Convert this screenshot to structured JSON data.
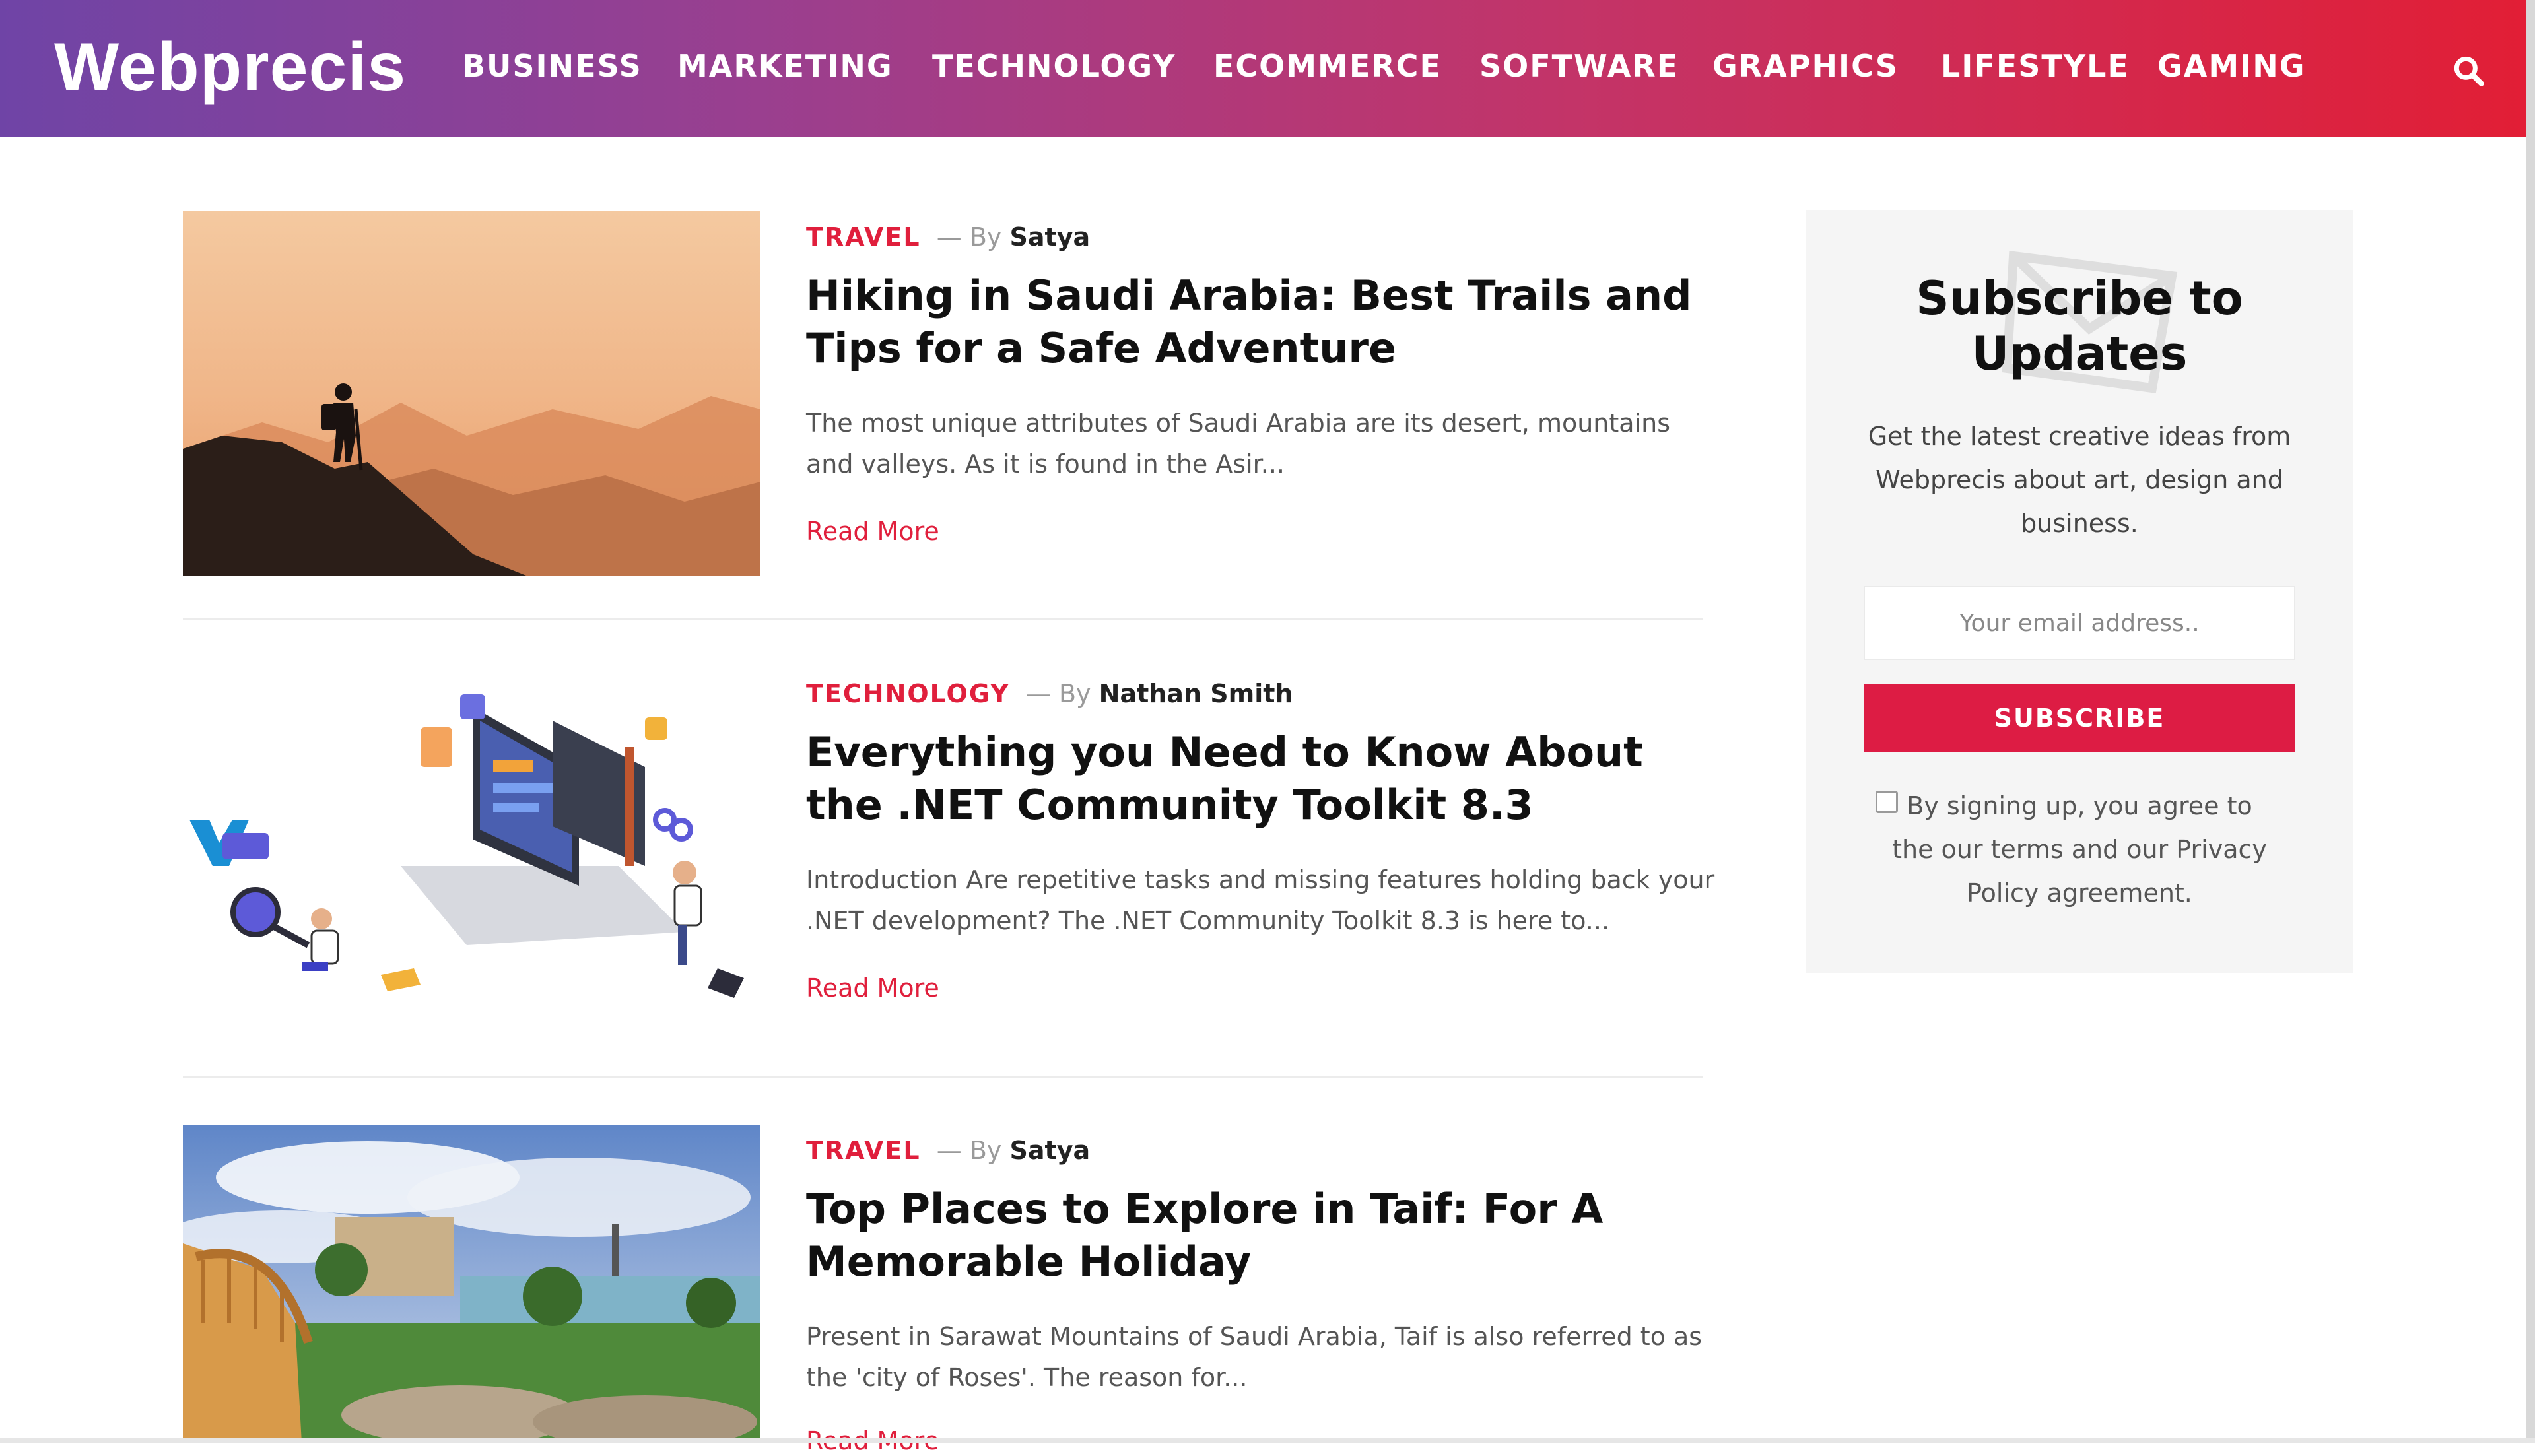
{
  "site": {
    "logo": "Webprecis"
  },
  "nav": [
    "BUSINESS",
    "MARKETING",
    "TECHNOLOGY",
    "ECOMMERCE",
    "SOFTWARE",
    "GRAPHICS",
    "LIFESTYLE",
    "GAMING"
  ],
  "icons": {
    "search": "search-icon",
    "email": "envelope-icon"
  },
  "colors": {
    "accent": "#e01f3c",
    "button": "#dd1c44",
    "header_start": "#6f44a6",
    "header_end": "#e21e35"
  },
  "posts": [
    {
      "category": "TRAVEL",
      "separator": "—",
      "by": "By",
      "author": "Satya",
      "title": "Hiking in Saudi Arabia: Best Trails and Tips for a Safe Adventure",
      "excerpt": "The most unique attributes of Saudi Arabia are its desert, mountains and valleys. As it is found in the Asir...",
      "read_more": "Read More"
    },
    {
      "category": "TECHNOLOGY",
      "separator": "—",
      "by": "By",
      "author": "Nathan Smith",
      "title": "Everything you Need to Know About the .NET Community Toolkit 8.3",
      "excerpt": "Introduction Are repetitive tasks and missing features holding back your .NET development? The .NET Community Toolkit 8.3 is here to...",
      "read_more": "Read More"
    },
    {
      "category": "TRAVEL",
      "separator": "—",
      "by": "By",
      "author": "Satya",
      "title": "Top Places to Explore in Taif: For A Memorable Holiday",
      "excerpt": "Present in Sarawat Mountains of Saudi Arabia, Taif is also referred to as the 'city of Roses'. The reason for...",
      "read_more": "Read More"
    }
  ],
  "sidebar": {
    "title": "Subscribe to Updates",
    "description": "Get the latest creative ideas from Webprecis about art, design and business.",
    "email_placeholder": "Your email address..",
    "subscribe_label": "SUBSCRIBE",
    "agree_text": "By signing up, you agree to the our terms and our Privacy Policy agreement."
  }
}
